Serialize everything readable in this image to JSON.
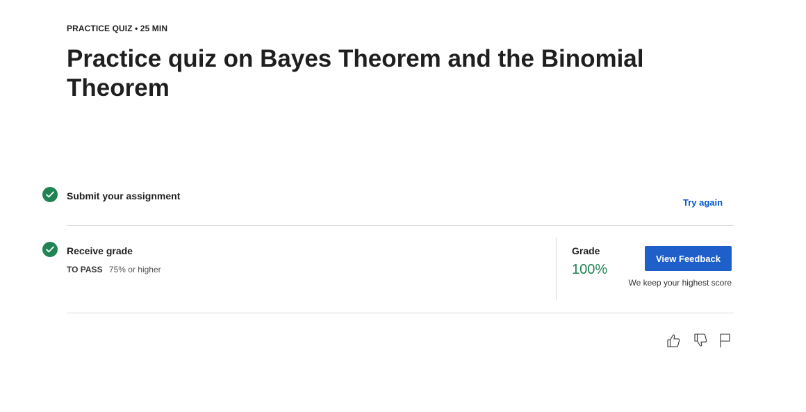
{
  "header": {
    "eyebrow": "PRACTICE QUIZ • 25 MIN",
    "title": "Practice quiz on Bayes Theorem and the Binomial Theorem"
  },
  "steps": {
    "submit": {
      "title": "Submit your assignment",
      "action_label": "Try again",
      "icon": "check-circle-icon"
    },
    "grade": {
      "title": "Receive grade",
      "pass_label": "TO PASS",
      "pass_value": "75% or higher",
      "icon": "check-circle-icon",
      "grade_label": "Grade",
      "grade_value": "100%",
      "feedback_button": "View Feedback",
      "note": "We keep your highest score"
    }
  },
  "actions": [
    {
      "name": "like",
      "icon": "thumbs-up-icon"
    },
    {
      "name": "dislike",
      "icon": "thumbs-down-icon"
    },
    {
      "name": "report",
      "icon": "flag-icon"
    }
  ],
  "colors": {
    "success": "#1f8354",
    "link": "#0056d2",
    "primary_button": "#1f5fc9",
    "divider": "#dcdcdc"
  }
}
